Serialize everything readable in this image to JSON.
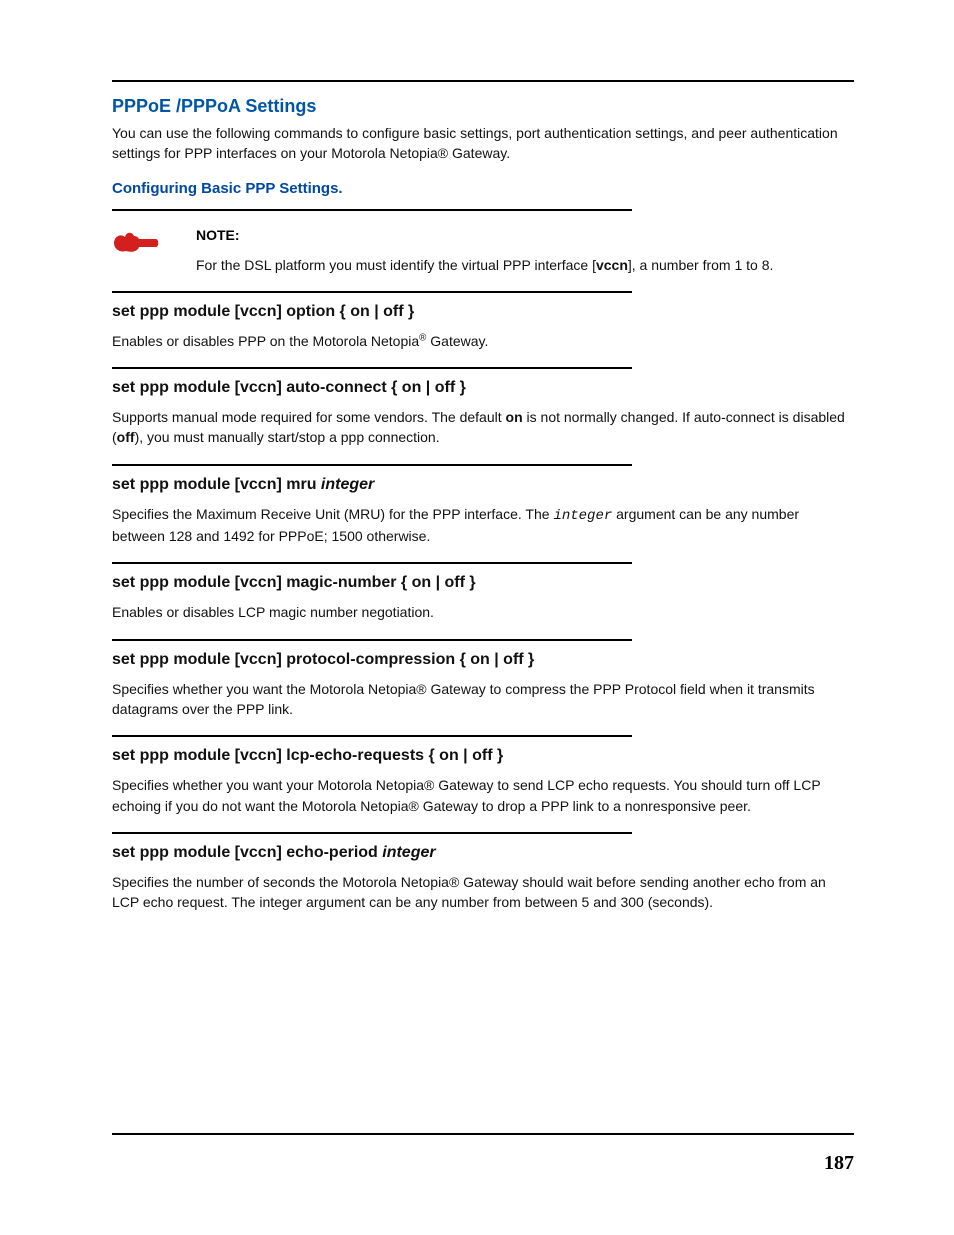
{
  "page_number": "187",
  "heading_main": "PPPoE /PPPoA Settings",
  "intro_text": "You can use the following commands to configure basic settings, port authentication settings, and peer authentication settings for PPP interfaces on your Motorola Netopia® Gateway.",
  "heading_sub": "Configuring Basic PPP Settings.",
  "note_label": "NOTE:",
  "note_prefix": "For the DSL platform you must identify the virtual PPP interface [",
  "note_bold": "vccn",
  "note_suffix": "], a number from 1 to 8.",
  "cmds": {
    "c1": {
      "heading": "set ppp module [vccn] option { on | off }",
      "p1a": "Enables or disables PPP on the Motorola Netopia",
      "p1b": " Gateway."
    },
    "c2": {
      "heading": "set ppp module [vccn] auto-connect { on | off }",
      "p_a": "Supports manual mode required for some vendors. The default ",
      "p_b": "on",
      "p_c": " is not normally changed. If auto-connect is disabled (",
      "p_d": "off",
      "p_e": "), you must manually start/stop a ppp connection."
    },
    "c3": {
      "h_pre": "set ppp module [vccn] mru ",
      "h_it": "integer",
      "p_a": "Specifies the Maximum Receive Unit (MRU) for the PPP interface. The ",
      "p_mono": "integer",
      "p_b": " argument can be any number between 128 and 1492 for PPPoE; 1500 otherwise."
    },
    "c4": {
      "heading": "set ppp module [vccn] magic-number { on | off }",
      "p": "Enables or disables LCP magic number negotiation."
    },
    "c5": {
      "heading": "set ppp module [vccn] protocol-compression { on | off }",
      "p": "Specifies whether you want the Motorola Netopia® Gateway to compress the PPP Protocol field when it transmits datagrams over the PPP link."
    },
    "c6": {
      "heading": "set ppp module [vccn] lcp-echo-requests { on | off }",
      "p": "Specifies whether you want your Motorola Netopia® Gateway to send LCP echo requests. You should turn off LCP echoing if you do not want the Motorola Netopia® Gateway to drop a PPP link to a nonresponsive peer."
    },
    "c7": {
      "h_pre": "set ppp module [vccn] echo-period ",
      "h_it": "integer",
      "p": "Specifies the number of seconds the Motorola Netopia® Gateway should wait before sending another echo from an LCP echo request. The integer argument can be any number from between 5 and 300 (seconds)."
    }
  }
}
